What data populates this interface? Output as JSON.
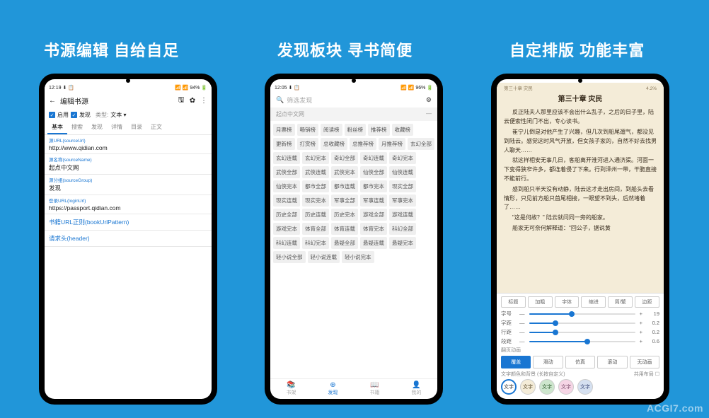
{
  "watermark": "ACGI7.com",
  "headings": {
    "h1": "书源编辑  自给自足",
    "h2": "发现板块  寻书简便",
    "h3": "自定排版  功能丰富"
  },
  "phone1": {
    "status_left": "12:19 ⬇ 📋",
    "status_right": "📶 📶 94% 🔋",
    "back": "←",
    "title": "编辑书源",
    "icon_save": "🖫",
    "icon_gear": "✿",
    "icon_more": "⋮",
    "chk_enable": "启用",
    "chk_discover": "发现",
    "type_label": "类型:",
    "type_value": "文本 ▾",
    "tabs": [
      "基本",
      "搜索",
      "发现",
      "详情",
      "目录",
      "正文"
    ],
    "fields": [
      {
        "label": "源URL(sourceUrl)",
        "value": "http://www.qidian.com"
      },
      {
        "label": "源名称(sourceName)",
        "value": "起点中文网"
      },
      {
        "label": "源分组(sourceGroup)",
        "value": "发现"
      },
      {
        "label": "登录URL(loginUrl)",
        "value": "https://passport.qidian.com"
      }
    ],
    "link1": "书籍URL正则(bookUrlPattern)",
    "link2": "请求头(header)"
  },
  "phone2": {
    "status_left": "12:05 ⬇ 📋",
    "status_right": "📶 📶 96% 🔋",
    "search_icon": "🔍",
    "search_ph": "筛选发现",
    "setting_icon": "⚙",
    "src_name": "起点中文网",
    "collapse": "—",
    "tags": [
      "月票榜",
      "畅销榜",
      "阅读榜",
      "粉丝榜",
      "推荐榜",
      "收藏榜",
      "更新榜",
      "打赏榜",
      "总收藏榜",
      "总推荐榜",
      "月推荐榜",
      "玄幻全部",
      "玄幻连载",
      "玄幻完本",
      "奇幻全部",
      "奇幻连载",
      "奇幻完本",
      "武侠全部",
      "武侠连载",
      "武侠完本",
      "仙侠全部",
      "仙侠连载",
      "仙侠完本",
      "都市全部",
      "都市连载",
      "都市完本",
      "现实全部",
      "现实连载",
      "现实完本",
      "军事全部",
      "军事连载",
      "军事完本",
      "历史全部",
      "历史连载",
      "历史完本",
      "游戏全部",
      "游戏连载",
      "游戏完本",
      "体育全部",
      "体育连载",
      "体育完本",
      "科幻全部",
      "科幻连载",
      "科幻完本",
      "悬疑全部",
      "悬疑连载",
      "悬疑完本",
      "轻小说全部",
      "轻小说连载",
      "轻小说完本"
    ],
    "nav": [
      {
        "icon": "📚",
        "label": "书架"
      },
      {
        "icon": "⊕",
        "label": "发现"
      },
      {
        "icon": "📖",
        "label": "书籍"
      },
      {
        "icon": "👤",
        "label": "我的"
      }
    ]
  },
  "phone3": {
    "hd_left": "第三十章 灾民",
    "hd_right": "4.2%",
    "chapter": "第三十章 灾民",
    "paras": [
      "反正陆夫人那里应该不会出什么乱子，之后的日子里，陆云便索性闭门不出，专心读书。",
      "崔宁儿倒是对他产生了兴趣，但几次到船尾遛气，都没见到陆云。感觉这时风气开放，但女孩子家的，自然不好去找男人聊天……",
      "就这样相安无事几日，客船离开淮河进入通济渠。河面一下变得狭窄许多，都连着侵了下来。行到泽州一带，干脆直接不能前行。",
      "感到船只半天没有动静，陆云这才走出房间，到船头去看情形，只见前方船只首尾相接，一眼望不到头，后然堵着了……",
      "\"这是何故？\" 陆云就问同一旁的船家。",
      "船家无可奈何解释道：\"回公子，据说黄"
    ],
    "toolbar": [
      "标题",
      "加粗",
      "字体",
      "缩进",
      "简/繁",
      "边距"
    ],
    "sliders": [
      {
        "label": "字号",
        "value": "19",
        "pct": 40
      },
      {
        "label": "字距",
        "value": "0.2",
        "pct": 25
      },
      {
        "label": "行距",
        "value": "0.2",
        "pct": 25
      },
      {
        "label": "段距",
        "value": "0.6",
        "pct": 55
      }
    ],
    "page_label": "翻页动画",
    "page_modes": [
      "覆盖",
      "滑动",
      "仿真",
      "滚动",
      "无动画"
    ],
    "theme_label": "文字颜色和背景 (长按自定义)",
    "share_bg": "共用布局 ☐",
    "swatch_text": "文字",
    "swatches": [
      {
        "bg": "#ffffff",
        "fg": "#333",
        "sel": true
      },
      {
        "bg": "#f4ecd8",
        "fg": "#5a4a2a"
      },
      {
        "bg": "#cde6cd",
        "fg": "#2a5a2a"
      },
      {
        "bg": "#f5d5e5",
        "fg": "#7a4a6a"
      },
      {
        "bg": "#d5e0f0",
        "fg": "#3a4a7a"
      }
    ]
  }
}
